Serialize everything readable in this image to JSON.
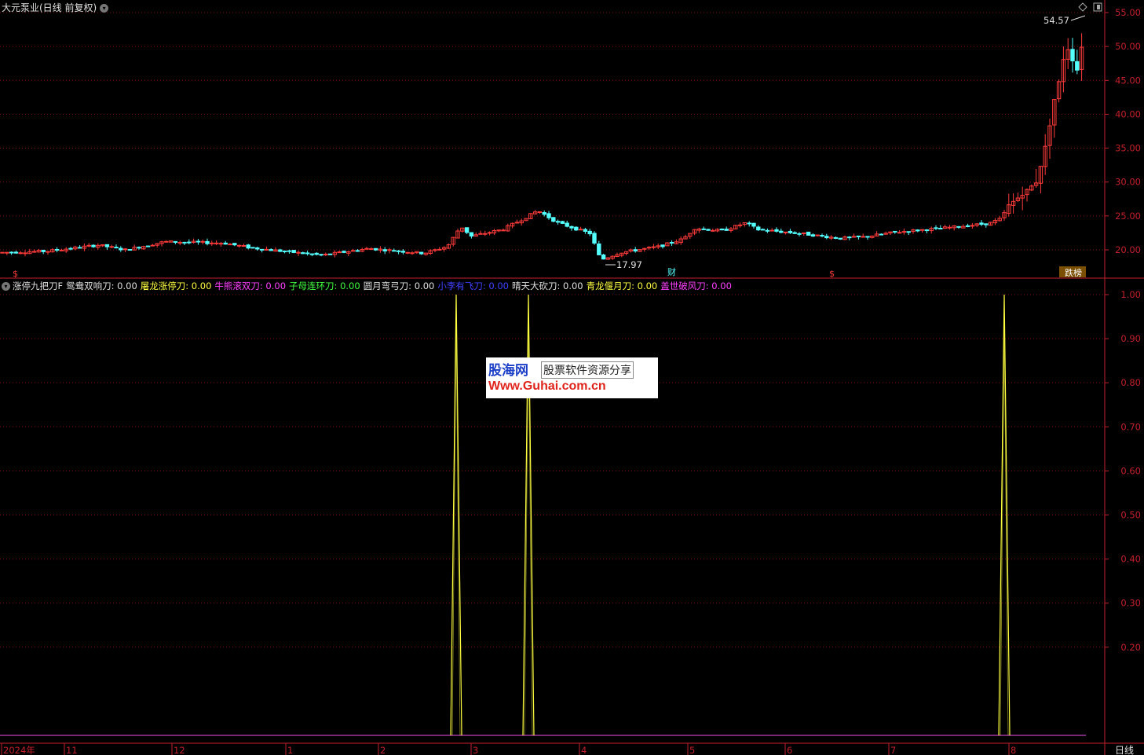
{
  "window_title": "大元泵业(日线 前复权)",
  "indicator": {
    "name": "涨停九把刀F",
    "items": [
      {
        "label": "鸳鸯双响刀: 0.00",
        "color": "#e0e0e0"
      },
      {
        "label": "屠龙涨停刀: 0.00",
        "color": "#ffff40"
      },
      {
        "label": "牛熊滚双刀: 0.00",
        "color": "#ff40ff"
      },
      {
        "label": "子母连环刀: 0.00",
        "color": "#40ff40"
      },
      {
        "label": "圆月弯弓刀: 0.00",
        "color": "#e0e0e0"
      },
      {
        "label": "小李有飞刀: 0.00",
        "color": "#4040ff"
      },
      {
        "label": "晴天大砍刀: 0.00",
        "color": "#e0e0e0"
      },
      {
        "label": "青龙偃月刀: 0.00",
        "color": "#ffff40"
      },
      {
        "label": "盖世破风刀: 0.00",
        "color": "#ff40ff"
      }
    ]
  },
  "price_axis": [
    "55.00",
    "50.00",
    "45.00",
    "40.00",
    "35.00",
    "30.00",
    "25.00",
    "20.00"
  ],
  "indicator_axis": [
    "1.00",
    "0.90",
    "0.80",
    "0.70",
    "0.60",
    "0.50",
    "0.40",
    "0.30",
    "0.20"
  ],
  "time_axis": [
    "2024年",
    "11",
    "12",
    "1",
    "2",
    "3",
    "4",
    "5",
    "6",
    "7",
    "8"
  ],
  "period_label": "日线",
  "annotations": {
    "high_price": "54.57",
    "low_price": "17.97",
    "finance_tag": "财",
    "rank_tag": "跌榜"
  },
  "watermark": {
    "logo": "股海网",
    "tagline": "股票软件资源分享",
    "url": "Www.Guhai.com.cn"
  },
  "colors": {
    "up": "#ff3b3b",
    "down": "#54ffff",
    "grid": "#7a1010",
    "axis": "#c0202b",
    "signal": "#ffff40",
    "baseline": "#c040c0"
  },
  "chart_data": {
    "type": "candlestick",
    "price_range": [
      15.5,
      56.5
    ],
    "signal_range": [
      0,
      1
    ],
    "indicator_signal_peaks_at_months": [
      "3",
      "3",
      "8"
    ],
    "indicator_signal_value": 1.0
  }
}
